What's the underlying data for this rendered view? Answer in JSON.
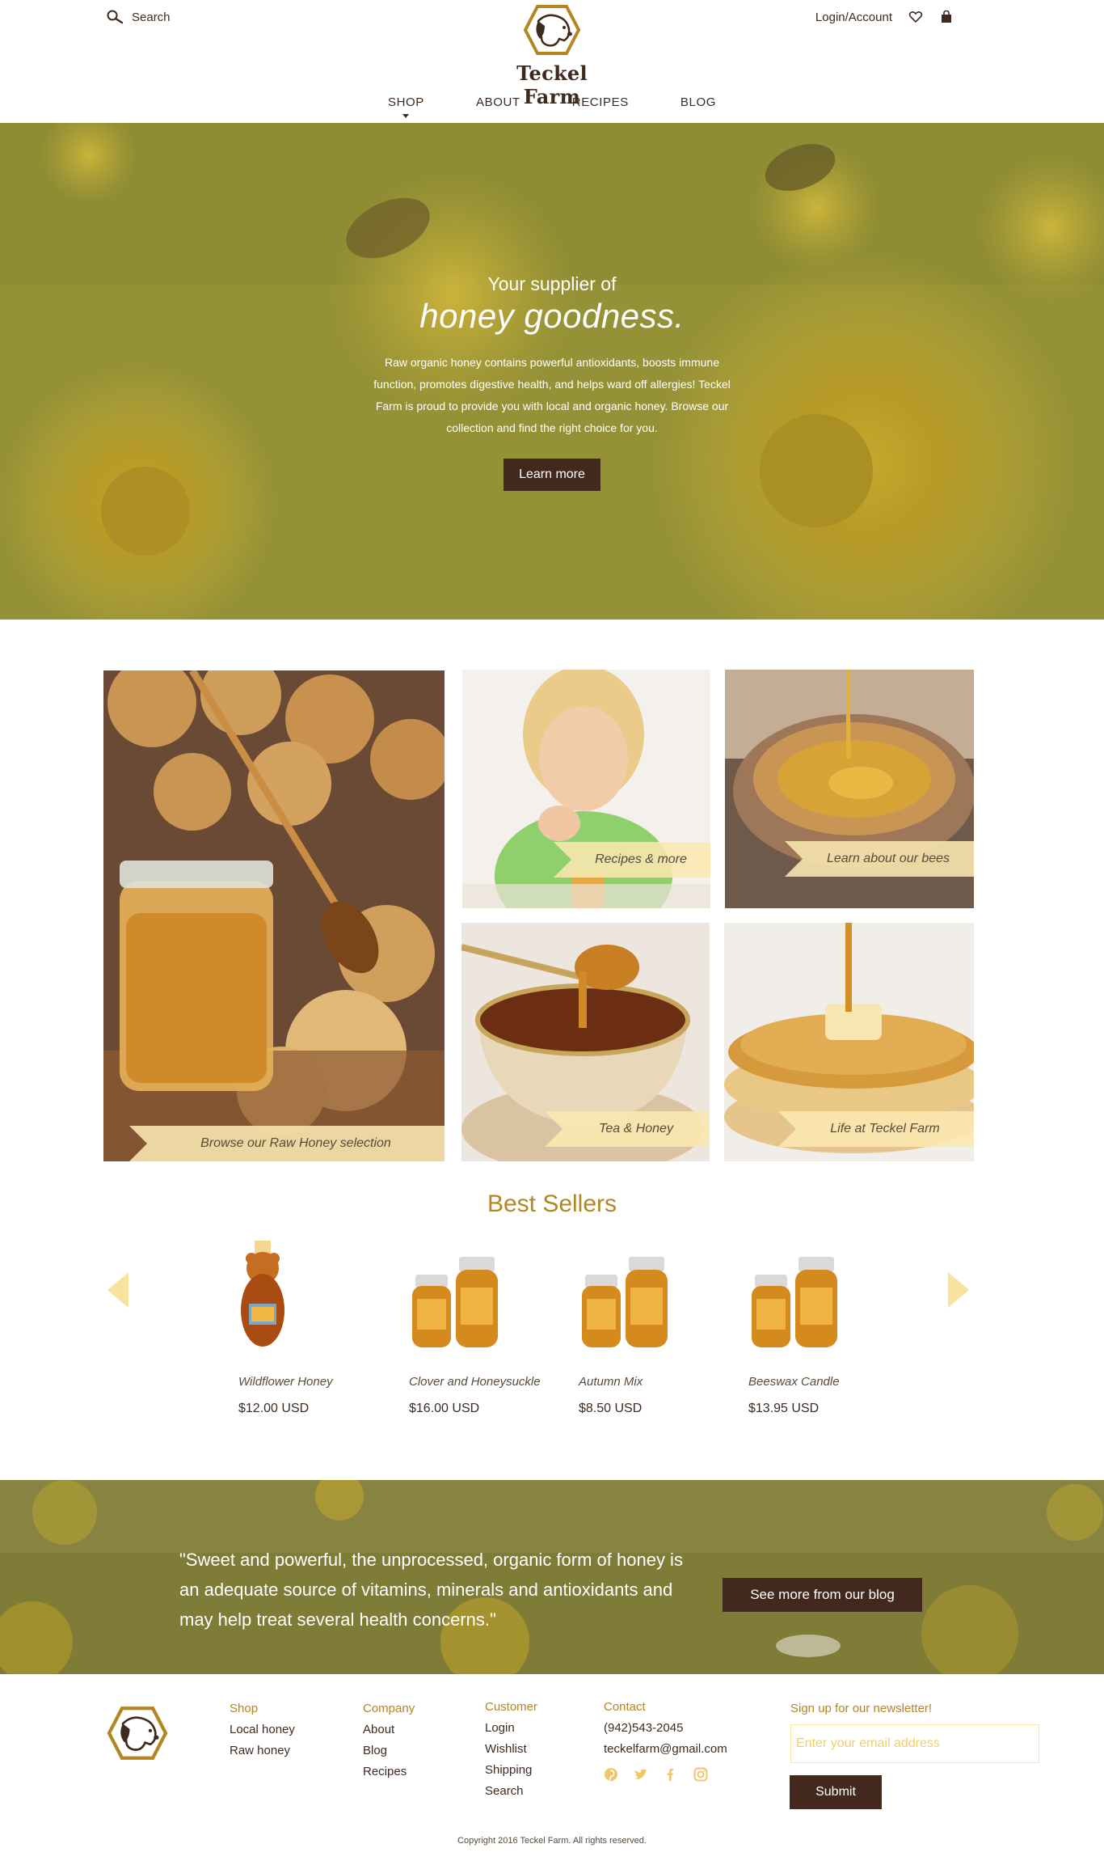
{
  "header": {
    "search_label": "Search",
    "brand": "Teckel Farm",
    "login_label": "Login/Account",
    "nav": [
      {
        "label": "SHOP",
        "active": true
      },
      {
        "label": "ABOUT"
      },
      {
        "label": "RECIPES"
      },
      {
        "label": "BLOG"
      }
    ]
  },
  "hero": {
    "kicker": "Your supplier of",
    "title": "honey goodness.",
    "body": "Raw organic honey contains powerful antioxidants, boosts immune function, promotes digestive health, and helps ward off allergies! Teckel Farm is proud to provide you with local and organic honey. Browse our collection and find the right choice for you.",
    "cta": "Learn more"
  },
  "tiles": [
    {
      "label": "Browse our Raw Honey selection"
    },
    {
      "label": "Recipes & more"
    },
    {
      "label": "Learn about our bees"
    },
    {
      "label": "Tea & Honey"
    },
    {
      "label": "Life at Teckel Farm"
    }
  ],
  "best_sellers": {
    "title": "Best Sellers",
    "products": [
      {
        "name": "Wildflower Honey",
        "price": "$12.00 USD"
      },
      {
        "name": "Clover and Honeysuckle",
        "price": "$16.00 USD"
      },
      {
        "name": "Autumn Mix",
        "price": "$8.50 USD"
      },
      {
        "name": "Beeswax Candle",
        "price": "$13.95 USD"
      }
    ]
  },
  "quote": {
    "text": "\"Sweet and powerful, the unprocessed, organic form of honey is an adequate source of vitamins, minerals and antioxidants and may help treat several health concerns.\"",
    "cta": "See more from our blog"
  },
  "footer": {
    "shop": {
      "heading": "Shop",
      "items": [
        "Local honey",
        "Raw honey"
      ]
    },
    "company": {
      "heading": "Company",
      "items": [
        "About",
        "Blog",
        "Recipes"
      ]
    },
    "customer": {
      "heading": "Customer",
      "items": [
        "Login",
        "Wishlist",
        "Shipping",
        "Search"
      ]
    },
    "contact": {
      "heading": "Contact",
      "phone": "(942)543-2045",
      "email": "teckelfarm@gmail.com"
    },
    "social_icons": [
      "pinterest-icon",
      "twitter-icon",
      "facebook-icon",
      "instagram-icon"
    ],
    "newsletter": {
      "heading": "Sign up for our newsletter!",
      "placeholder": "Enter your email address",
      "submit": "Submit"
    },
    "copyright": "Copyright 2016 Teckel Farm. All rights reserved."
  },
  "colors": {
    "brown": "#43281e",
    "gold": "#b38622",
    "ribbon": "#fae8b0",
    "hero_overlay": "#8d8a2e"
  }
}
